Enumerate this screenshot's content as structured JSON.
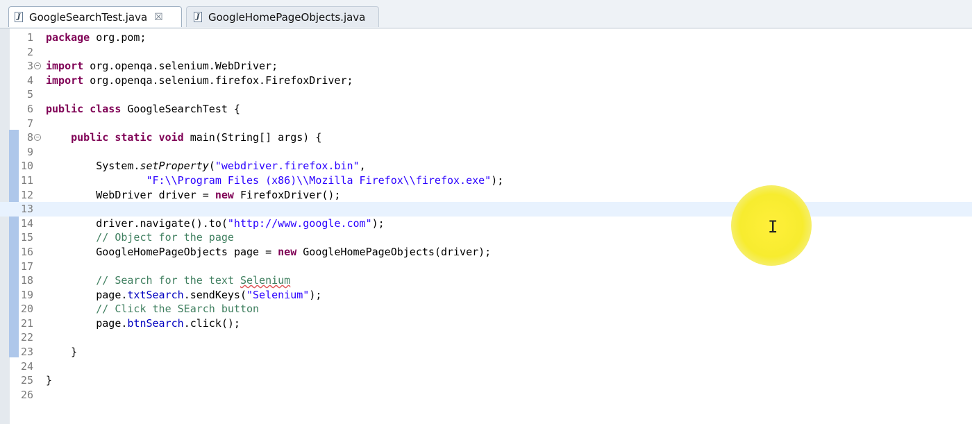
{
  "tabs": [
    {
      "label": "GoogleSearchTest.java",
      "active": true,
      "close": "☒"
    },
    {
      "label": "GoogleHomePageObjects.java",
      "active": false
    }
  ],
  "editor": {
    "cursor_line": 13,
    "lines": [
      {
        "n": "1"
      },
      {
        "n": "2"
      },
      {
        "n": "3"
      },
      {
        "n": "4"
      },
      {
        "n": "5"
      },
      {
        "n": "6"
      },
      {
        "n": "7"
      },
      {
        "n": "8"
      },
      {
        "n": "9"
      },
      {
        "n": "10"
      },
      {
        "n": "11"
      },
      {
        "n": "12"
      },
      {
        "n": "13"
      },
      {
        "n": "14"
      },
      {
        "n": "15"
      },
      {
        "n": "16"
      },
      {
        "n": "17"
      },
      {
        "n": "18"
      },
      {
        "n": "19"
      },
      {
        "n": "20"
      },
      {
        "n": "21"
      },
      {
        "n": "22"
      },
      {
        "n": "23"
      },
      {
        "n": "24"
      },
      {
        "n": "25"
      },
      {
        "n": "26"
      }
    ],
    "code": {
      "package": "package",
      "pkgname": " org.pom;",
      "import": "import",
      "imp1": " org.openqa.selenium.WebDriver;",
      "imp2": " org.openqa.selenium.firefox.FirefoxDriver;",
      "public": "public",
      "class": "class",
      "classname": " GoogleSearchTest {",
      "static": "static",
      "void": "void",
      "mainsig": " main(String[] ",
      "args": "args",
      "mainend": ") {",
      "system": "System.",
      "setprop": "setProperty",
      "open": "(",
      "str1": "\"webdriver.firefox.bin\"",
      "comma": ",",
      "str2": "\"F:\\\\Program Files (x86)\\\\Mozilla Firefox\\\\firefox.exe\"",
      "close_semi": ");",
      "webdriver": "WebDriver ",
      "driver": "driver",
      "eq": " = ",
      "new": "new",
      "ffdriver": " FirefoxDriver();",
      "navigate": ".navigate().to(",
      "url": "\"http://www.google.com\"",
      "c1": "// Object for the page",
      "ghpo": "GoogleHomePageObjects ",
      "page": "page",
      "ghpo_new": " GoogleHomePageObjects(",
      "c2a": "// Search for the text ",
      "c2b": "Selenium",
      "dot": ".",
      "txtsearch": "txtSearch",
      "sendkeys": ".sendKeys(",
      "str3": "\"Selenium\"",
      "c3": "// Click the SEarch button",
      "btnsearch": "btnSearch",
      "click": ".click();",
      "rbrace": "}"
    }
  },
  "icons": {
    "file": "java-file-icon",
    "fold": "fold-toggle-icon",
    "cursor": "ibeam-cursor-icon"
  },
  "colors": {
    "keyword": "#7f0055",
    "string": "#2a00ff",
    "comment": "#3f7f5f",
    "field": "#0000c0",
    "highlight": "#ffef3a"
  }
}
